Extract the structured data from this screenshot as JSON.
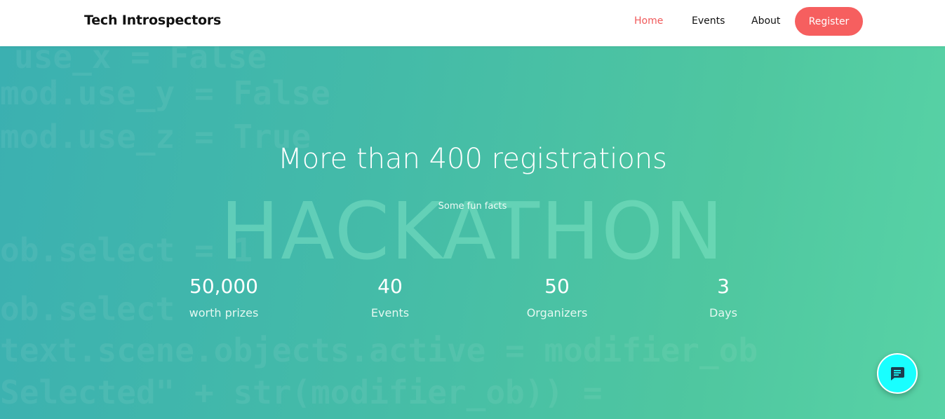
{
  "navbar": {
    "brand": "Tech Introspectors",
    "links": [
      "Home",
      "Events",
      "About"
    ],
    "register_label": "Register",
    "active_color": "#f0595a",
    "button_color": "#f65f5f"
  },
  "hero": {
    "title": "More than 400 registrations",
    "subtitle": "Some fun facts",
    "watermark": "HACKATHON",
    "background_code": [
      "use_x = False",
      "mod.use_y = False",
      "mod.use_z = True",
      "ob.select = 1",
      "ob.select",
      "text.scene.objects.active = modifier_ob",
      "Selected\" + str(modifier_ob)) ="
    ],
    "stats": [
      {
        "value": "50,000",
        "label": "worth prizes"
      },
      {
        "value": "40",
        "label": "Events"
      },
      {
        "value": "50",
        "label": "Organizers"
      },
      {
        "value": "3",
        "label": "Days"
      }
    ]
  },
  "chat": {
    "icon": "chat-icon",
    "color": "#19ffff"
  }
}
